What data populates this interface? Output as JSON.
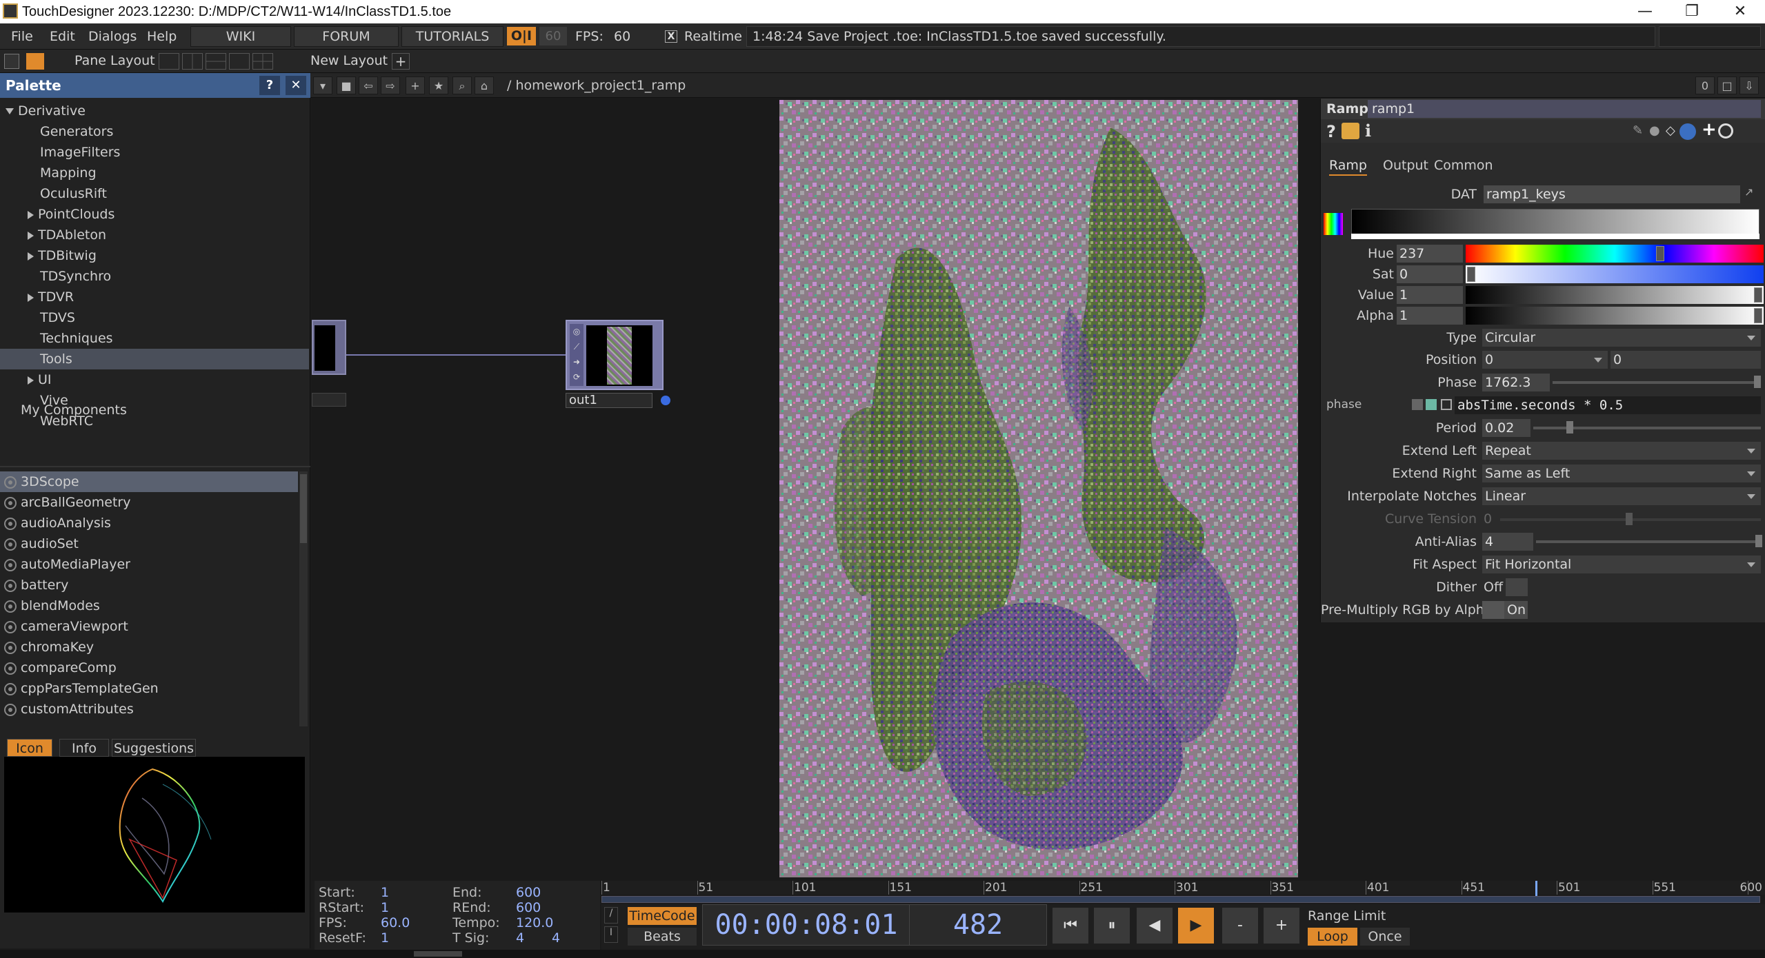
{
  "window": {
    "title": "TouchDesigner 2023.12230: D:/MDP/CT2/W11-W14/InClassTD1.5.toe",
    "minimize": "—",
    "maximize": "❐",
    "close": "✕"
  },
  "menubar": {
    "items": [
      "File",
      "Edit",
      "Dialogs",
      "Help"
    ],
    "tabs": [
      "WIKI",
      "FORUM",
      "TUTORIALS"
    ],
    "oi": "O|I",
    "fps_cap": "60",
    "fps_label": "FPS:",
    "fps_value": "60",
    "realtime_check": "X",
    "realtime_label": "Realtime",
    "status": "1:48:24 Save Project .toe: InClassTD1.5.toe saved successfully."
  },
  "layoutbar": {
    "pane_layout": "Pane Layout",
    "new_layout": "New Layout",
    "add": "+"
  },
  "palette": {
    "title": "Palette",
    "help": "?",
    "close": "✕",
    "root": "Derivative",
    "tree": [
      {
        "label": "Generators",
        "expander": false
      },
      {
        "label": "ImageFilters",
        "expander": false
      },
      {
        "label": "Mapping",
        "expander": false
      },
      {
        "label": "OculusRift",
        "expander": false
      },
      {
        "label": "PointClouds",
        "expander": true
      },
      {
        "label": "TDAbleton",
        "expander": true
      },
      {
        "label": "TDBitwig",
        "expander": true
      },
      {
        "label": "TDSynchro",
        "expander": false
      },
      {
        "label": "TDVR",
        "expander": true
      },
      {
        "label": "TDVS",
        "expander": false
      },
      {
        "label": "Techniques",
        "expander": false
      },
      {
        "label": "Tools",
        "expander": false,
        "selected": true
      },
      {
        "label": "UI",
        "expander": true
      },
      {
        "label": "Vive",
        "expander": false
      },
      {
        "label": "WebRTC",
        "expander": false
      }
    ],
    "my_components": "My Components",
    "components": [
      "3DScope",
      "arcBallGeometry",
      "audioAnalysis",
      "audioSet",
      "autoMediaPlayer",
      "battery",
      "blendModes",
      "cameraViewport",
      "chromaKey",
      "compareComp",
      "cppParsTemplateGen",
      "customAttributes"
    ],
    "subtabs": [
      "Icon",
      "Info",
      "Suggestions"
    ]
  },
  "network": {
    "path": "/ homework_project1_ramp",
    "zoom_indicator": "0",
    "node_name": "out1"
  },
  "params": {
    "op_type": "Ramp",
    "op_name": "ramp1",
    "tabs": [
      "Ramp",
      "Output",
      "Common"
    ],
    "dat_label": "DAT",
    "dat_value": "ramp1_keys",
    "hue_label": "Hue",
    "hue_value": "237",
    "sat_label": "Sat",
    "sat_value": "0",
    "value_label": "Value",
    "value_value": "1",
    "alpha_label": "Alpha",
    "alpha_value": "1",
    "type_label": "Type",
    "type_value": "Circular",
    "position_label": "Position",
    "position_x": "0",
    "position_y": "0",
    "phase_label": "Phase",
    "phase_value": "1762.3",
    "phase_expr_label": "phase",
    "phase_expr": "absTime.seconds * 0.5",
    "period_label": "Period",
    "period_value": "0.02",
    "extend_left_label": "Extend Left",
    "extend_left_value": "Repeat",
    "extend_right_label": "Extend Right",
    "extend_right_value": "Same as Left",
    "interp_label": "Interpolate Notches",
    "interp_value": "Linear",
    "tension_label": "Curve Tension",
    "tension_value": "0",
    "antialias_label": "Anti-Alias",
    "antialias_value": "4",
    "fit_label": "Fit Aspect",
    "fit_value": "Fit Horizontal",
    "dither_label": "Dither",
    "dither_value": "Off",
    "premult_label": "Pre-Multiply RGB by Alpha",
    "premult_value": "On"
  },
  "timeline": {
    "start_label": "Start:",
    "start": "1",
    "end_label": "End:",
    "end": "600",
    "rstart_label": "RStart:",
    "rstart": "1",
    "rend_label": "REnd:",
    "rend": "600",
    "fps_label": "FPS:",
    "fps": "60.0",
    "tempo_label": "Tempo:",
    "tempo": "120.0",
    "resetf_label": "ResetF:",
    "resetf": "1",
    "tsig_label": "T Sig:",
    "tsig_a": "4",
    "tsig_b": "4",
    "ruler": [
      "1",
      "51",
      "101",
      "151",
      "201",
      "251",
      "301",
      "351",
      "401",
      "451",
      "501",
      "551",
      "600"
    ],
    "timecode_btn": "TimeCode",
    "beats_btn": "Beats",
    "timecode": "00:00:08:01",
    "frame": "482",
    "range_limit": "Range Limit",
    "loop": "Loop",
    "once": "Once",
    "minus": "-",
    "plus": "+"
  }
}
